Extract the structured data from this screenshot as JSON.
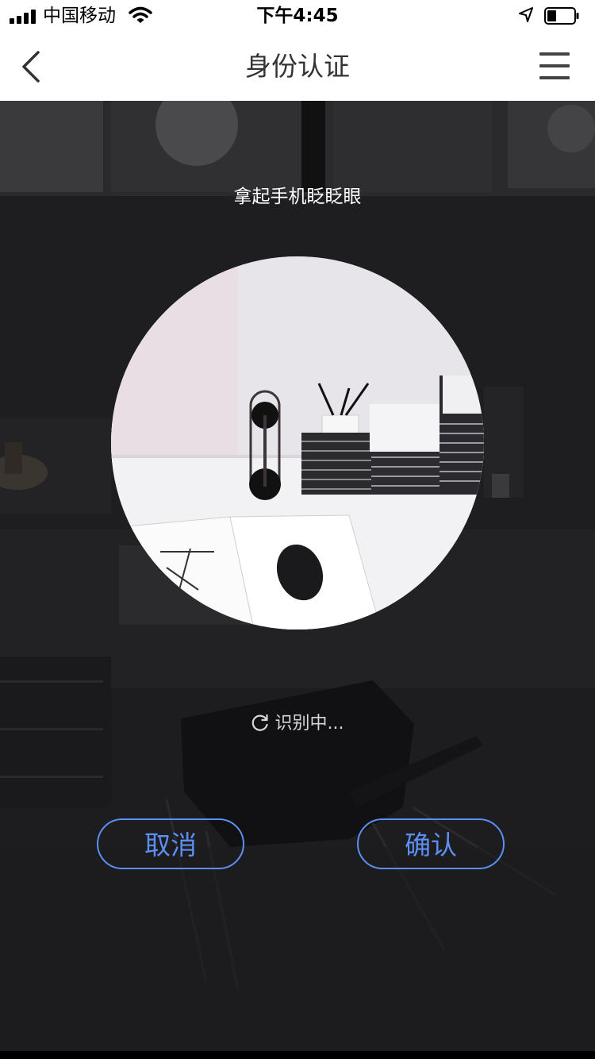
{
  "status_bar": {
    "carrier": "中国移动",
    "time": "下午4:45"
  },
  "nav": {
    "title": "身份认证"
  },
  "camera": {
    "instruction": "拿起手机眨眨眼",
    "status_text": "识别中..."
  },
  "buttons": {
    "cancel": "取消",
    "confirm": "确认"
  },
  "colors": {
    "accent": "#5c8ff5",
    "overlay": "#1d1d1f"
  }
}
